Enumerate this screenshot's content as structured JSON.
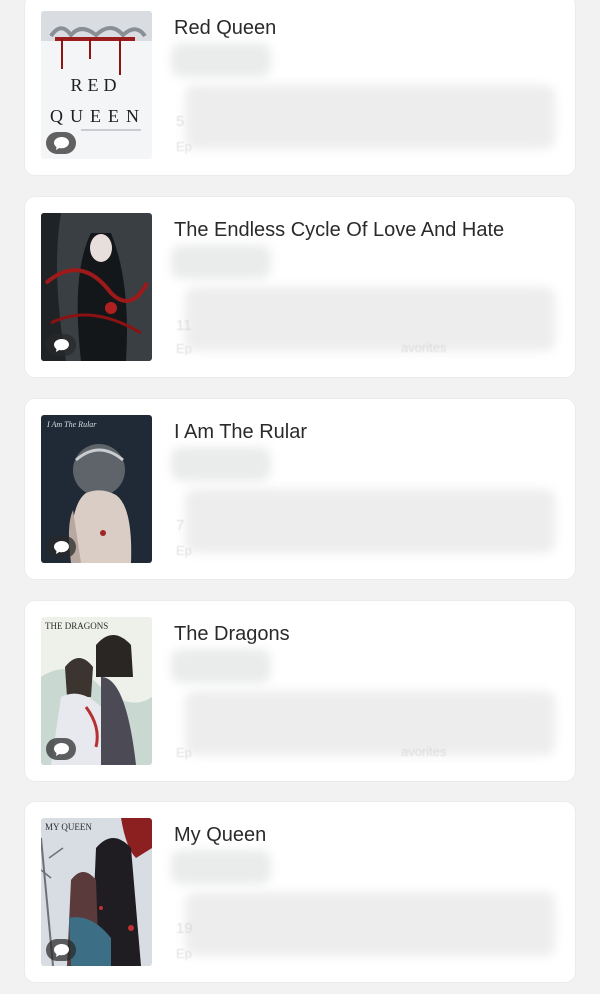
{
  "books": [
    {
      "title": "Red Queen",
      "cover_text": [
        "RED",
        "QUEEN"
      ],
      "faded_count": "5",
      "faded_label": "Ep",
      "faded_fav": ""
    },
    {
      "title": "The Endless Cycle Of Love And Hate",
      "faded_count": "11",
      "faded_label": "Ep",
      "faded_fav": "avorites"
    },
    {
      "title": "I Am The Rular",
      "cover_text": [
        "I Am The Rular"
      ],
      "faded_count": "7",
      "faded_label": "Ep",
      "faded_fav": ""
    },
    {
      "title": "The Dragons",
      "cover_text": [
        "THE DRAGONS"
      ],
      "faded_count": "",
      "faded_label": "Ep",
      "faded_fav": "avorites"
    },
    {
      "title": "My Queen",
      "cover_text": [
        "MY QUEEN"
      ],
      "faded_count": "19",
      "faded_label": "Ep",
      "faded_fav": ""
    }
  ],
  "icons": {
    "comment": "comment-icon"
  },
  "colors": {
    "background": "#f2f2f2",
    "card": "#ffffff",
    "title": "#2a2a2a"
  }
}
